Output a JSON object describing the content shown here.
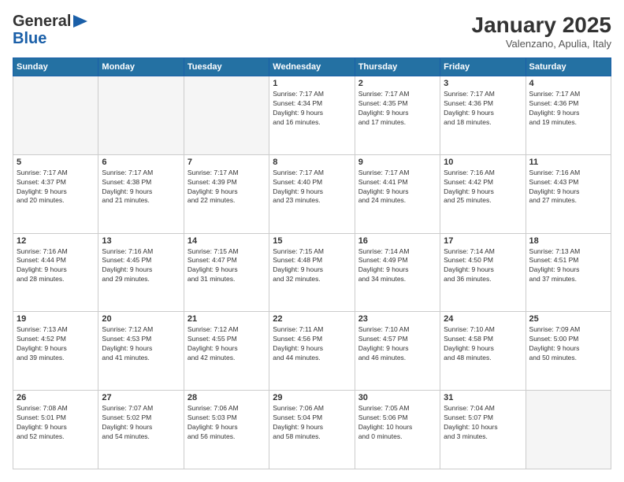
{
  "header": {
    "logo_general": "General",
    "logo_blue": "Blue",
    "month": "January 2025",
    "location": "Valenzano, Apulia, Italy"
  },
  "weekdays": [
    "Sunday",
    "Monday",
    "Tuesday",
    "Wednesday",
    "Thursday",
    "Friday",
    "Saturday"
  ],
  "weeks": [
    [
      {
        "day": "",
        "info": ""
      },
      {
        "day": "",
        "info": ""
      },
      {
        "day": "",
        "info": ""
      },
      {
        "day": "1",
        "info": "Sunrise: 7:17 AM\nSunset: 4:34 PM\nDaylight: 9 hours\nand 16 minutes."
      },
      {
        "day": "2",
        "info": "Sunrise: 7:17 AM\nSunset: 4:35 PM\nDaylight: 9 hours\nand 17 minutes."
      },
      {
        "day": "3",
        "info": "Sunrise: 7:17 AM\nSunset: 4:36 PM\nDaylight: 9 hours\nand 18 minutes."
      },
      {
        "day": "4",
        "info": "Sunrise: 7:17 AM\nSunset: 4:36 PM\nDaylight: 9 hours\nand 19 minutes."
      }
    ],
    [
      {
        "day": "5",
        "info": "Sunrise: 7:17 AM\nSunset: 4:37 PM\nDaylight: 9 hours\nand 20 minutes."
      },
      {
        "day": "6",
        "info": "Sunrise: 7:17 AM\nSunset: 4:38 PM\nDaylight: 9 hours\nand 21 minutes."
      },
      {
        "day": "7",
        "info": "Sunrise: 7:17 AM\nSunset: 4:39 PM\nDaylight: 9 hours\nand 22 minutes."
      },
      {
        "day": "8",
        "info": "Sunrise: 7:17 AM\nSunset: 4:40 PM\nDaylight: 9 hours\nand 23 minutes."
      },
      {
        "day": "9",
        "info": "Sunrise: 7:17 AM\nSunset: 4:41 PM\nDaylight: 9 hours\nand 24 minutes."
      },
      {
        "day": "10",
        "info": "Sunrise: 7:16 AM\nSunset: 4:42 PM\nDaylight: 9 hours\nand 25 minutes."
      },
      {
        "day": "11",
        "info": "Sunrise: 7:16 AM\nSunset: 4:43 PM\nDaylight: 9 hours\nand 27 minutes."
      }
    ],
    [
      {
        "day": "12",
        "info": "Sunrise: 7:16 AM\nSunset: 4:44 PM\nDaylight: 9 hours\nand 28 minutes."
      },
      {
        "day": "13",
        "info": "Sunrise: 7:16 AM\nSunset: 4:45 PM\nDaylight: 9 hours\nand 29 minutes."
      },
      {
        "day": "14",
        "info": "Sunrise: 7:15 AM\nSunset: 4:47 PM\nDaylight: 9 hours\nand 31 minutes."
      },
      {
        "day": "15",
        "info": "Sunrise: 7:15 AM\nSunset: 4:48 PM\nDaylight: 9 hours\nand 32 minutes."
      },
      {
        "day": "16",
        "info": "Sunrise: 7:14 AM\nSunset: 4:49 PM\nDaylight: 9 hours\nand 34 minutes."
      },
      {
        "day": "17",
        "info": "Sunrise: 7:14 AM\nSunset: 4:50 PM\nDaylight: 9 hours\nand 36 minutes."
      },
      {
        "day": "18",
        "info": "Sunrise: 7:13 AM\nSunset: 4:51 PM\nDaylight: 9 hours\nand 37 minutes."
      }
    ],
    [
      {
        "day": "19",
        "info": "Sunrise: 7:13 AM\nSunset: 4:52 PM\nDaylight: 9 hours\nand 39 minutes."
      },
      {
        "day": "20",
        "info": "Sunrise: 7:12 AM\nSunset: 4:53 PM\nDaylight: 9 hours\nand 41 minutes."
      },
      {
        "day": "21",
        "info": "Sunrise: 7:12 AM\nSunset: 4:55 PM\nDaylight: 9 hours\nand 42 minutes."
      },
      {
        "day": "22",
        "info": "Sunrise: 7:11 AM\nSunset: 4:56 PM\nDaylight: 9 hours\nand 44 minutes."
      },
      {
        "day": "23",
        "info": "Sunrise: 7:10 AM\nSunset: 4:57 PM\nDaylight: 9 hours\nand 46 minutes."
      },
      {
        "day": "24",
        "info": "Sunrise: 7:10 AM\nSunset: 4:58 PM\nDaylight: 9 hours\nand 48 minutes."
      },
      {
        "day": "25",
        "info": "Sunrise: 7:09 AM\nSunset: 5:00 PM\nDaylight: 9 hours\nand 50 minutes."
      }
    ],
    [
      {
        "day": "26",
        "info": "Sunrise: 7:08 AM\nSunset: 5:01 PM\nDaylight: 9 hours\nand 52 minutes."
      },
      {
        "day": "27",
        "info": "Sunrise: 7:07 AM\nSunset: 5:02 PM\nDaylight: 9 hours\nand 54 minutes."
      },
      {
        "day": "28",
        "info": "Sunrise: 7:06 AM\nSunset: 5:03 PM\nDaylight: 9 hours\nand 56 minutes."
      },
      {
        "day": "29",
        "info": "Sunrise: 7:06 AM\nSunset: 5:04 PM\nDaylight: 9 hours\nand 58 minutes."
      },
      {
        "day": "30",
        "info": "Sunrise: 7:05 AM\nSunset: 5:06 PM\nDaylight: 10 hours\nand 0 minutes."
      },
      {
        "day": "31",
        "info": "Sunrise: 7:04 AM\nSunset: 5:07 PM\nDaylight: 10 hours\nand 3 minutes."
      },
      {
        "day": "",
        "info": ""
      }
    ]
  ],
  "colors": {
    "header_bg": "#2471a3",
    "accent_blue": "#1a5fa8"
  }
}
